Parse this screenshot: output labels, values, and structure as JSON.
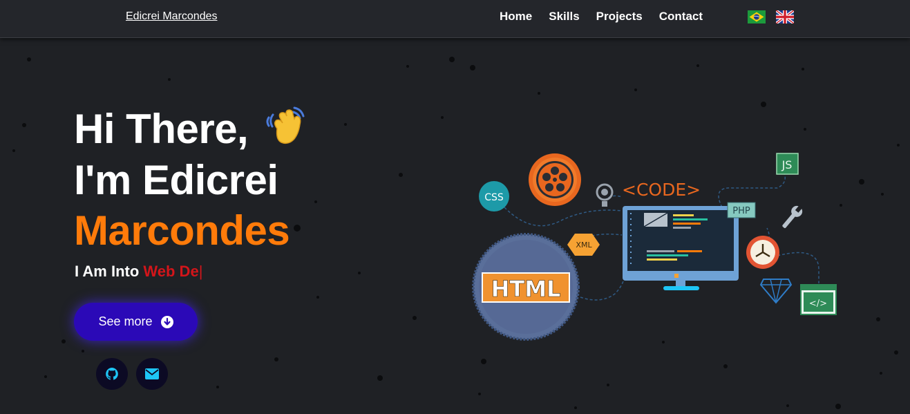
{
  "navbar": {
    "brand": "Edicrei Marcondes",
    "links": [
      "Home",
      "Skills",
      "Projects",
      "Contact"
    ],
    "flags": [
      "brazil-flag-icon",
      "uk-flag-icon"
    ]
  },
  "hero": {
    "line1": "Hi There,",
    "line2": "I'm Edicrei",
    "line3": "Marcondes",
    "typing_prefix": "I Am Into ",
    "typing_text": "Web De",
    "typing_cursor": "|",
    "button_label": "See more",
    "button_icon": "arrow-down-circle-icon",
    "socials": [
      "github-icon",
      "email-icon"
    ]
  },
  "illustration": {
    "labels": {
      "css": "CSS",
      "code": "<CODE>",
      "js": "JS",
      "php": "PHP",
      "xml": "XML",
      "html": "HTML",
      "tag": "</>"
    }
  },
  "colors": {
    "background": "#1f2125",
    "navbar": "#24262b",
    "accent_orange": "#ff7b0a",
    "typing_red": "#d3151a",
    "button": "#2b09b7",
    "social_bg": "#0c0a24",
    "social_icon": "#1ec5f5"
  }
}
